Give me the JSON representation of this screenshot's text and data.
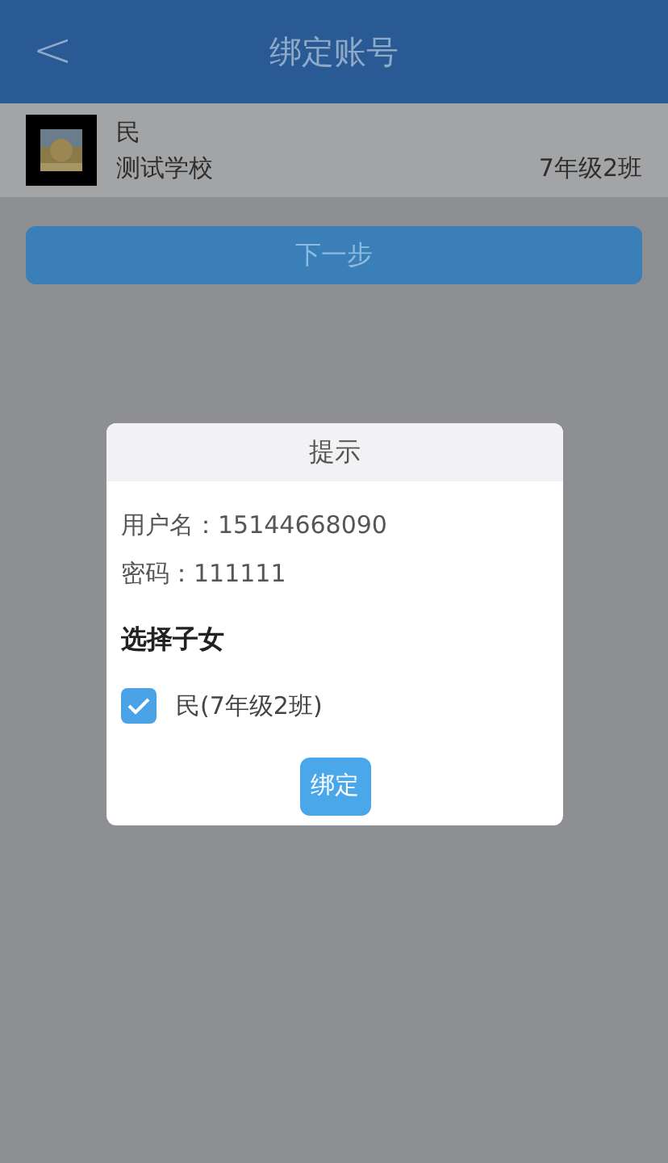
{
  "header": {
    "back": "<",
    "title": "绑定账号"
  },
  "student": {
    "name": "民",
    "school": "测试学校",
    "class": "7年级2班"
  },
  "next_button": "下一步",
  "dialog": {
    "title": "提示",
    "lines": [
      {
        "label": "用户名：",
        "value": "15144668090"
      },
      {
        "label": "密码：",
        "value": "111111"
      }
    ],
    "section": "选择子女",
    "children": [
      {
        "label": "民(7年级2班)",
        "checked": true
      }
    ],
    "bind_button": "绑定"
  }
}
